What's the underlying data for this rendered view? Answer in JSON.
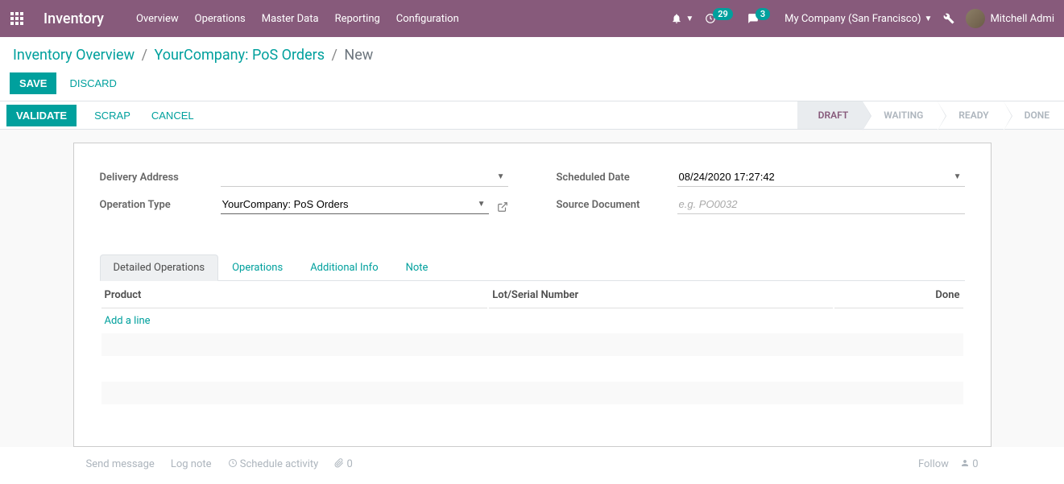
{
  "topnav": {
    "app_title": "Inventory",
    "menu": [
      "Overview",
      "Operations",
      "Master Data",
      "Reporting",
      "Configuration"
    ],
    "activities_count": "29",
    "discuss_count": "3",
    "company": "My Company (San Francisco)",
    "username": "Mitchell Admi"
  },
  "breadcrumb": {
    "items": [
      "Inventory Overview",
      "YourCompany: PoS Orders"
    ],
    "current": "New"
  },
  "ctrl": {
    "save": "Save",
    "discard": "Discard"
  },
  "statusbar": {
    "validate": "Validate",
    "scrap": "Scrap",
    "cancel": "Cancel",
    "steps": [
      "Draft",
      "Waiting",
      "Ready",
      "Done"
    ]
  },
  "form": {
    "delivery_address_label": "Delivery Address",
    "delivery_address_value": "",
    "operation_type_label": "Operation Type",
    "operation_type_value": "YourCompany: PoS Orders",
    "scheduled_date_label": "Scheduled Date",
    "scheduled_date_value": "08/24/2020 17:27:42",
    "source_document_label": "Source Document",
    "source_document_placeholder": "e.g. PO0032",
    "source_document_value": ""
  },
  "tabs": [
    "Detailed Operations",
    "Operations",
    "Additional Info",
    "Note"
  ],
  "table": {
    "col_product": "Product",
    "col_lot": "Lot/Serial Number",
    "col_done": "Done",
    "add_line": "Add a line"
  },
  "chatter": {
    "send": "Send message",
    "log": "Log note",
    "schedule": "Schedule activity",
    "attach_count": "0",
    "follow": "Follow",
    "followers": "0"
  }
}
